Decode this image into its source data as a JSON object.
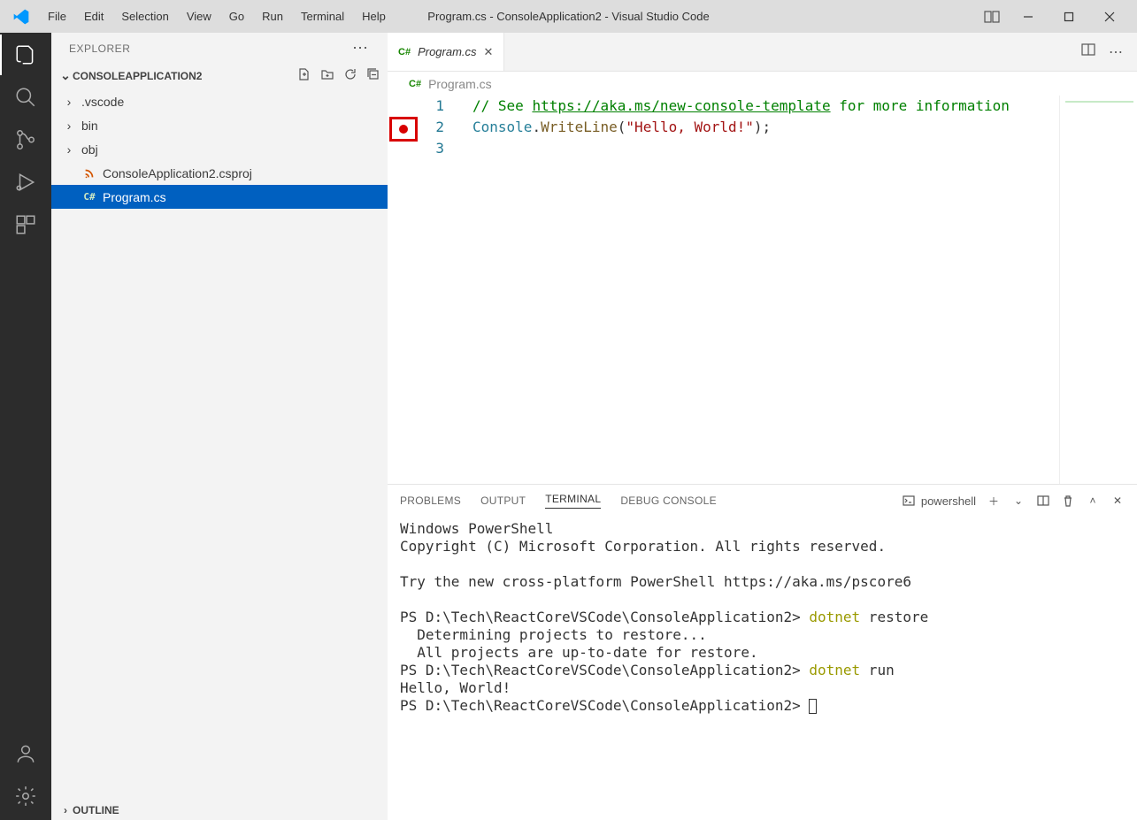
{
  "window": {
    "title": "Program.cs - ConsoleApplication2 - Visual Studio Code"
  },
  "menu": {
    "file": "File",
    "edit": "Edit",
    "selection": "Selection",
    "view": "View",
    "go": "Go",
    "run": "Run",
    "terminal": "Terminal",
    "help": "Help"
  },
  "sidebar": {
    "title": "EXPLORER",
    "project": "CONSOLEAPPLICATION2",
    "items": [
      {
        "type": "folder",
        "name": ".vscode"
      },
      {
        "type": "folder",
        "name": "bin"
      },
      {
        "type": "folder",
        "name": "obj"
      },
      {
        "type": "file",
        "name": "ConsoleApplication2.csproj",
        "icon": "rss"
      },
      {
        "type": "file",
        "name": "Program.cs",
        "icon": "cs",
        "selected": true
      }
    ],
    "outline": "OUTLINE"
  },
  "editor": {
    "tab_label": "Program.cs",
    "breadcrumb": "Program.cs",
    "lines": {
      "l1_prefix": "// See ",
      "l1_link": "https://aka.ms/new-console-template",
      "l1_suffix": " for more information",
      "l2_a": "Console",
      "l2_b": ".",
      "l2_c": "WriteLine",
      "l2_d": "(",
      "l2_e": "\"Hello, World!\"",
      "l2_f": ");"
    },
    "line_numbers": {
      "l1": "1",
      "l2": "2",
      "l3": "3"
    }
  },
  "panel": {
    "tabs": {
      "problems": "PROBLEMS",
      "output": "OUTPUT",
      "terminal": "TERMINAL",
      "debug": "DEBUG CONSOLE"
    },
    "shell_name": "powershell",
    "terminal": {
      "l1": "Windows PowerShell",
      "l2": "Copyright (C) Microsoft Corporation. All rights reserved.",
      "l3": "",
      "l4": "Try the new cross-platform PowerShell https://aka.ms/pscore6",
      "l5": "",
      "p1": "PS D:\\Tech\\ReactCoreVSCode\\ConsoleApplication2> ",
      "c1a": "dotnet",
      "c1b": " restore",
      "r1": "  Determining projects to restore...",
      "r2": "  All projects are up-to-date for restore.",
      "p2": "PS D:\\Tech\\ReactCoreVSCode\\ConsoleApplication2> ",
      "c2a": "dotnet",
      "c2b": " run",
      "r3": "Hello, World!",
      "p3": "PS D:\\Tech\\ReactCoreVSCode\\ConsoleApplication2> "
    }
  }
}
